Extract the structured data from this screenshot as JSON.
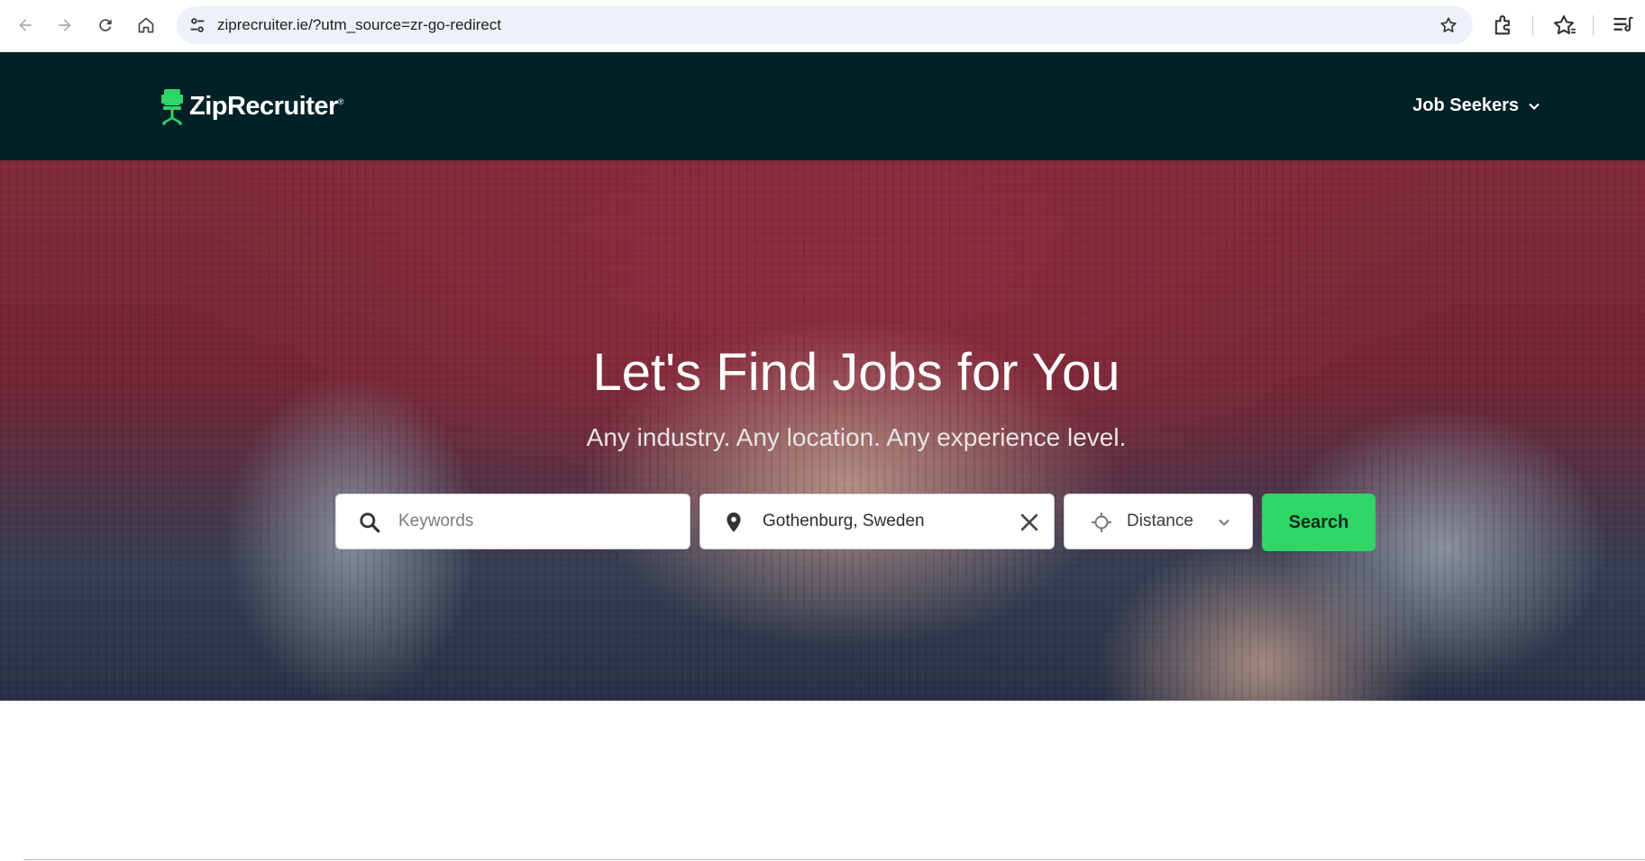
{
  "browser": {
    "url": "ziprecruiter.ie/?utm_source=zr-go-redirect",
    "icons": {
      "back": "arrow-left-icon",
      "forward": "arrow-right-icon",
      "reload": "reload-icon",
      "home": "home-icon",
      "site_info": "tune-icon",
      "bookmark": "star-icon",
      "extensions": "puzzle-icon",
      "favorites": "star-list-icon",
      "reading_list": "reading-list-icon"
    }
  },
  "header": {
    "logo_text": "ZipRecruiter",
    "logo_mark": "®",
    "nav_label": "Job Seekers",
    "background": "#002126"
  },
  "hero": {
    "title": "Let's Find Jobs for You",
    "subtitle": "Any industry. Any location. Any experience level."
  },
  "search": {
    "keywords_placeholder": "Keywords",
    "location_value": "Gothenburg, Sweden",
    "distance_label": "Distance",
    "button_label": "Search",
    "button_color": "#2fd565"
  }
}
